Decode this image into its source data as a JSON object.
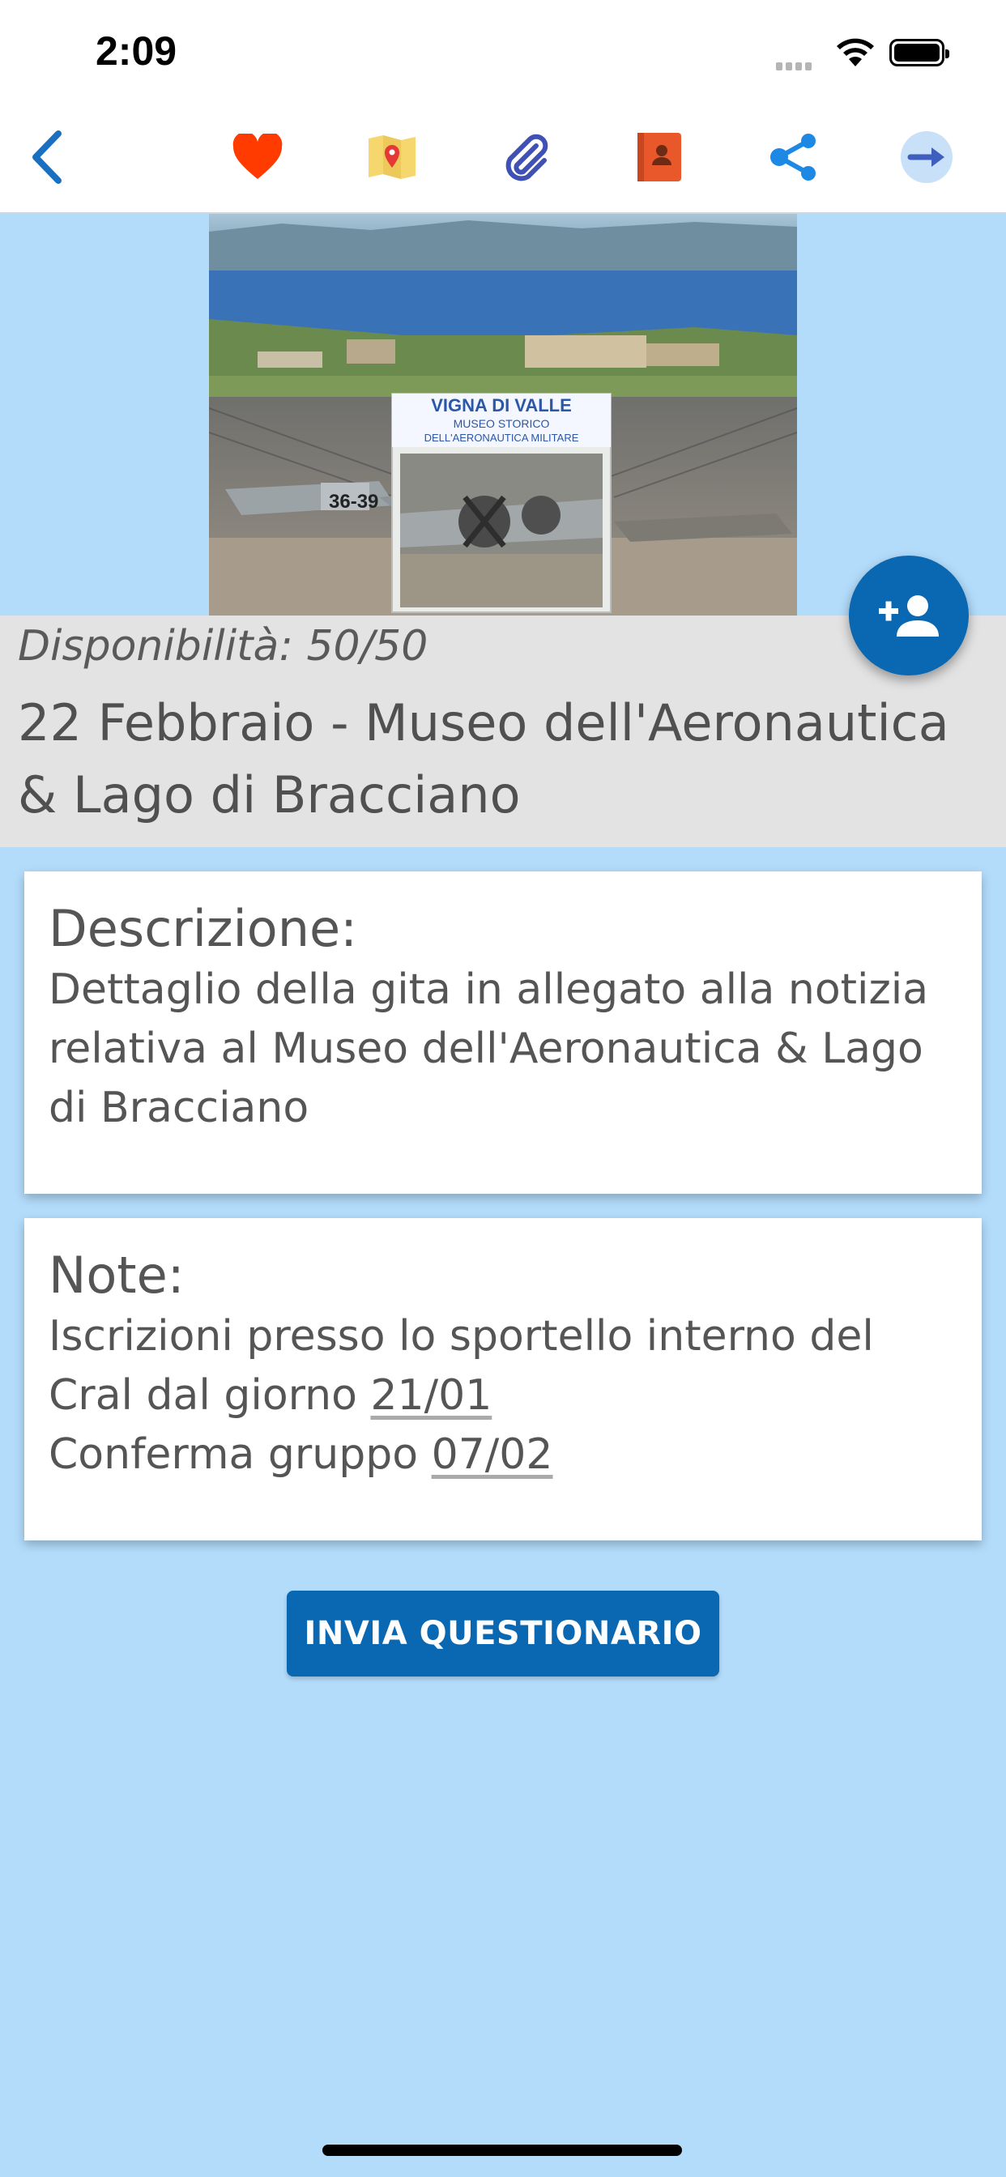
{
  "status_bar": {
    "time": "2:09"
  },
  "toolbar": {
    "icons": [
      "back-icon",
      "heart-icon",
      "map-icon",
      "paperclip-icon",
      "contact-book-icon",
      "share-icon",
      "arrow-right-icon"
    ],
    "colors": {
      "back": "#1a6fc0",
      "heart": "#ff3b00",
      "map": "#f5d76e",
      "clip": "#3f51b5",
      "contact": "#e8582b",
      "share": "#1e88e5",
      "next": "#3f5fbf"
    }
  },
  "hero": {
    "sign_line1": "VIGNA DI VALLE",
    "sign_line2": "MUSEO STORICO",
    "sign_line3": "DELL'AERONAUTICA MILITARE",
    "plane_number": "36-39"
  },
  "event": {
    "availability": "Disponibilità: 50/50",
    "title": "22 Febbraio - Museo dell'Aeronautica & Lago di Bracciano"
  },
  "description": {
    "heading": "Descrizione:",
    "body": "Dettaglio della gita in allegato alla notizia relativa al Museo dell'Aeronautica & Lago di Bracciano"
  },
  "notes": {
    "heading": "Note:",
    "line1_prefix": "Iscrizioni presso lo sportello interno del Cral dal giorno ",
    "line1_date": "21/01",
    "line2_prefix": "Conferma gruppo ",
    "line2_date": "07/02"
  },
  "actions": {
    "send_questionnaire": "INVIA QUESTIONARIO",
    "fab_icon": "add-person-icon"
  }
}
